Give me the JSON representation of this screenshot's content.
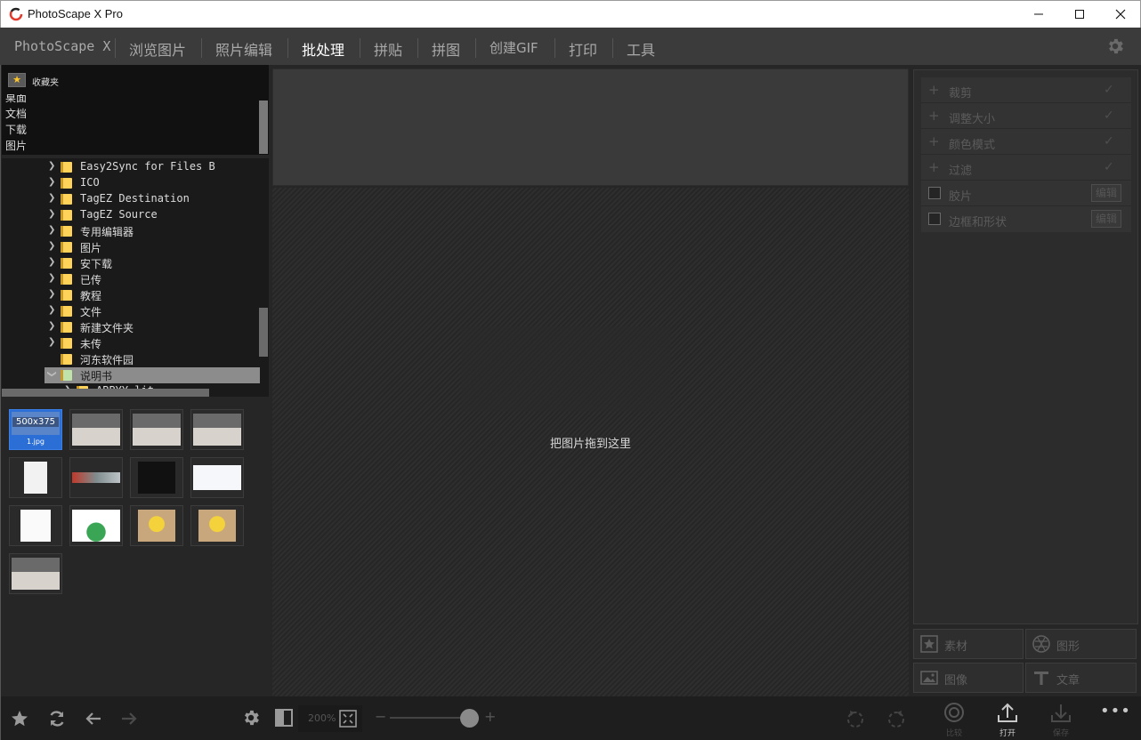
{
  "window": {
    "title": "PhotoScape X Pro",
    "controls": [
      "minimize",
      "maximize",
      "close"
    ]
  },
  "nav": {
    "items": [
      {
        "label": "PhotoScape X",
        "active": false
      },
      {
        "label": "浏览图片",
        "active": false
      },
      {
        "label": "照片编辑",
        "active": false
      },
      {
        "label": "批处理",
        "active": true
      },
      {
        "label": "拼贴",
        "active": false
      },
      {
        "label": "拼图",
        "active": false
      },
      {
        "label": "创建GIF",
        "active": false
      },
      {
        "label": "打印",
        "active": false
      },
      {
        "label": "工具",
        "active": false
      }
    ],
    "settings_icon": "gear-icon"
  },
  "favorites": {
    "header": "收藏夹",
    "items": [
      "桌面",
      "文档",
      "下载",
      "图片"
    ]
  },
  "folder_tree": {
    "items": [
      {
        "label": "Easy2Sync for Files B",
        "expandable": true
      },
      {
        "label": "ICO",
        "expandable": true
      },
      {
        "label": "TagEZ Destination",
        "expandable": true
      },
      {
        "label": "TagEZ Source",
        "expandable": true
      },
      {
        "label": "专用编辑器",
        "expandable": true
      },
      {
        "label": "图片",
        "expandable": true
      },
      {
        "label": "安下载",
        "expandable": true
      },
      {
        "label": "已传",
        "expandable": true
      },
      {
        "label": "教程",
        "expandable": true
      },
      {
        "label": "文件",
        "expandable": true
      },
      {
        "label": "新建文件夹",
        "expandable": true
      },
      {
        "label": "未传",
        "expandable": true
      },
      {
        "label": "河东软件园",
        "expandable": false
      },
      {
        "label": "说明书",
        "expandable": true,
        "selected": true
      },
      {
        "label": "ABBYY_lit",
        "expandable": true
      }
    ]
  },
  "thumbnails": {
    "selected_size": "500x375",
    "selected_name": "1.jpg",
    "count": 13
  },
  "center": {
    "drop_hint": "把图片拖到这里"
  },
  "batch_ops": {
    "rows": [
      {
        "label": "裁剪",
        "kind": "add"
      },
      {
        "label": "调整大小",
        "kind": "add"
      },
      {
        "label": "颜色模式",
        "kind": "add"
      },
      {
        "label": "过滤",
        "kind": "add"
      },
      {
        "label": "胶片",
        "kind": "toggle",
        "edit": "编辑"
      },
      {
        "label": "边框和形状",
        "kind": "toggle",
        "edit": "编辑"
      }
    ]
  },
  "tools": {
    "items": [
      {
        "label": "素材",
        "icon": "sticker-icon"
      },
      {
        "label": "图形",
        "icon": "shape-icon"
      },
      {
        "label": "图像",
        "icon": "image-icon"
      },
      {
        "label": "文章",
        "icon": "text-icon"
      }
    ]
  },
  "bottom": {
    "zoom": "200%",
    "compare_label": "比较",
    "open_label": "打开",
    "save_label": "保存"
  },
  "colors": {
    "accent": "#2b6fd6",
    "folder": "#ffd35a",
    "star": "#ffc829"
  }
}
